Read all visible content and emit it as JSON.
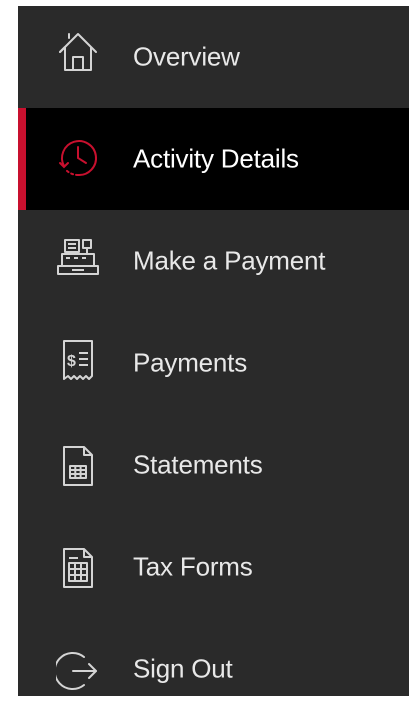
{
  "colors": {
    "background": "#2a2a2a",
    "active_background": "#000000",
    "accent": "#c8102e",
    "text": "#e8e8e8",
    "icon": "#d4d4d4"
  },
  "nav": {
    "items": [
      {
        "label": "Overview",
        "icon": "house-icon",
        "active": false
      },
      {
        "label": "Activity Details",
        "icon": "clock-history-icon",
        "active": true
      },
      {
        "label": "Make a Payment",
        "icon": "cash-register-icon",
        "active": false
      },
      {
        "label": "Payments",
        "icon": "receipt-dollar-icon",
        "active": false
      },
      {
        "label": "Statements",
        "icon": "document-table-icon",
        "active": false
      },
      {
        "label": "Tax Forms",
        "icon": "document-form-icon",
        "active": false
      },
      {
        "label": "Sign Out",
        "icon": "sign-out-icon",
        "active": false
      }
    ]
  }
}
